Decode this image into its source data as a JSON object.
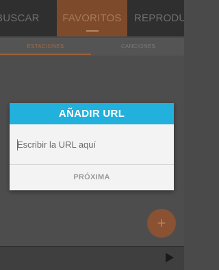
{
  "top_tabs": [
    {
      "label": "BUSCAR"
    },
    {
      "label": "FAVORITOS"
    },
    {
      "label": "REPRODUCIR"
    }
  ],
  "sub_tabs": [
    {
      "label": "ESTACIONES"
    },
    {
      "label": "CANCIONES"
    }
  ],
  "fab": {
    "label": "+"
  },
  "player": {
    "icon": "play-icon"
  },
  "dialog": {
    "title": "AÑADIR URL",
    "input": {
      "placeholder": "Escribir la URL aquí",
      "value": ""
    },
    "button": "PRÓXIMA"
  },
  "colors": {
    "dialog_title_bg": "#22b0dc",
    "accent_active_tab": "#7d4b2b",
    "fab": "#8a5232"
  }
}
